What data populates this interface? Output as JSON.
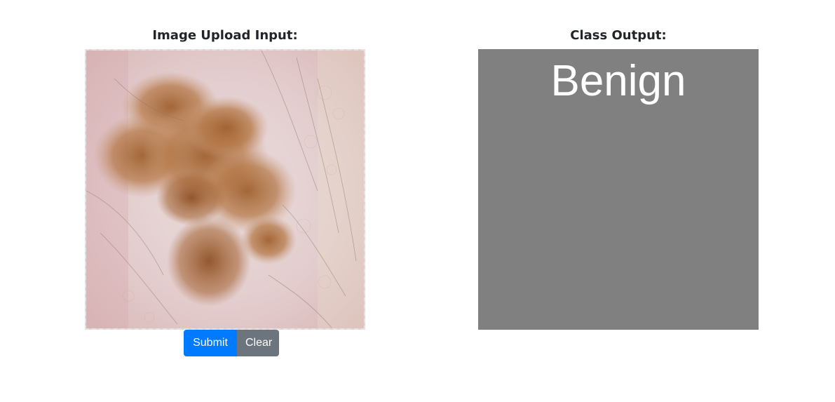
{
  "input_panel": {
    "heading": "Image Upload Input:"
  },
  "buttons": {
    "submit_label": "Submit",
    "clear_label": "Clear"
  },
  "output_panel": {
    "heading": "Class Output:",
    "prediction": "Benign"
  },
  "colors": {
    "submit": "#007bff",
    "clear": "#6c757d",
    "output_background": "#808080"
  }
}
